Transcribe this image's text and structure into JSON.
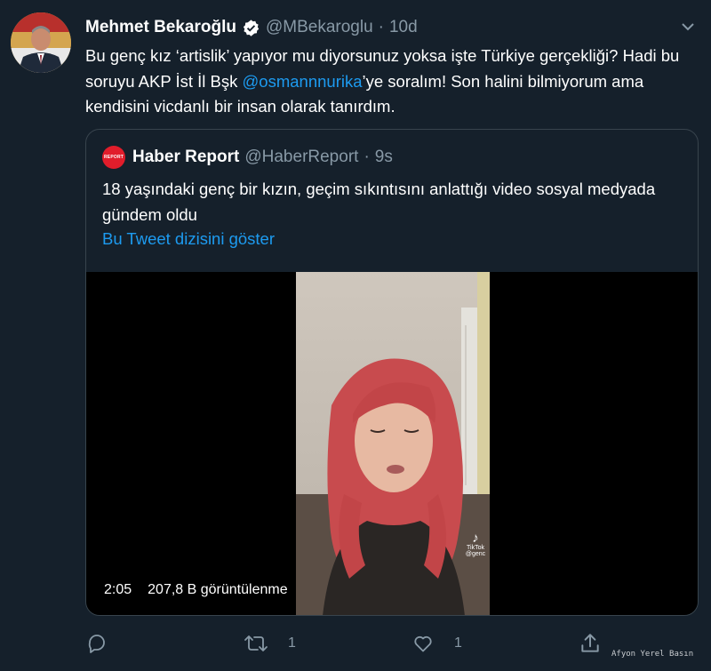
{
  "tweet": {
    "author_name": "Mehmet Bekaroğlu",
    "handle": "@MBekaroglu",
    "separator": "·",
    "time": "10d",
    "text_part1": "Bu genç kız ‘artislik’ yapıyor mu diyorsunuz yoksa işte Türkiye gerçekliği? Hadi bu soruyu AKP İst İl Bşk ",
    "mention": "@osmannnurika",
    "text_part2": "’ye soralım! Son halini bilmiyorum ama kendisini vicdanlı bir insan olarak tanırdım."
  },
  "quoted": {
    "logo_text": "REPORT",
    "author_name": "Haber Report",
    "handle": "@HaberReport",
    "separator": "·",
    "time": "9s",
    "text": "18 yaşındaki genç bir kızın, geçim sıkıntısını anlattığı video sosyal medyada gündem oldu",
    "thread_link": "Bu Tweet dizisini göster",
    "video": {
      "duration": "2:05",
      "views": "207,8 B görüntülenme",
      "tiktok_label": "TikTok",
      "tiktok_handle": "@genc"
    }
  },
  "actions": {
    "reply_count": "",
    "retweet_count": "1",
    "like_count": "1"
  },
  "watermark": "Afyon Yerel Basın",
  "colors": {
    "background": "#15202b",
    "link": "#1d9bf0",
    "muted": "#8899a6",
    "border": "#38444d"
  }
}
